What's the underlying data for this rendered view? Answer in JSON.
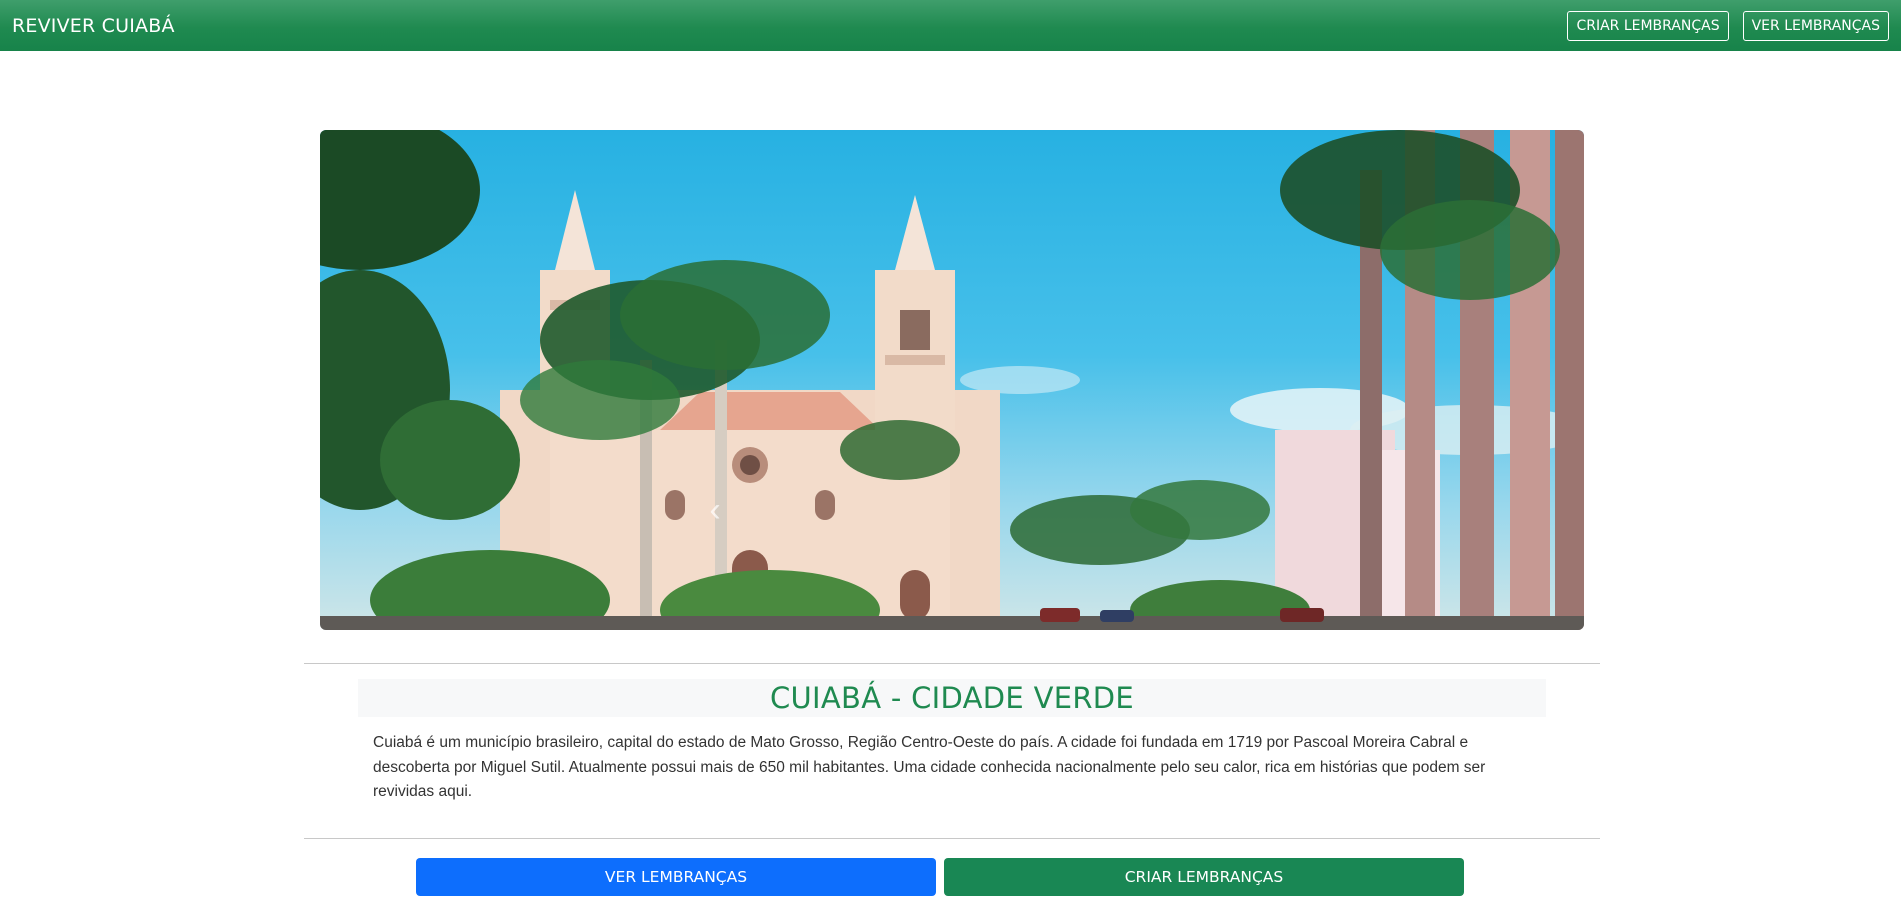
{
  "navbar": {
    "brand": "REVIVER CUIABÁ",
    "create_label": "CRIAR LEMBRANÇAS",
    "view_label": "VER LEMBRANÇAS"
  },
  "carousel": {
    "prev_icon": "chevron-left-icon",
    "next_icon": "chevron-right-icon"
  },
  "section": {
    "title": "CUIABÁ - CIDADE VERDE",
    "description": "Cuiabá é um município brasileiro, capital do estado de Mato Grosso, Região Centro-Oeste do país. A cidade foi fundada em 1719 por Pascoal Moreira Cabral e descoberta por Miguel Sutil. Atualmente possui mais de 650 mil habitantes. Uma cidade conhecida nacionalmente pelo seu calor, rica em histórias que podem ser revividas aqui."
  },
  "actions": {
    "view_label": "VER LEMBRANÇAS",
    "create_label": "CRIAR LEMBRANÇAS"
  },
  "colors": {
    "brand_green": "#1f8a50",
    "primary_blue": "#0d6efd",
    "success_green": "#198754"
  }
}
